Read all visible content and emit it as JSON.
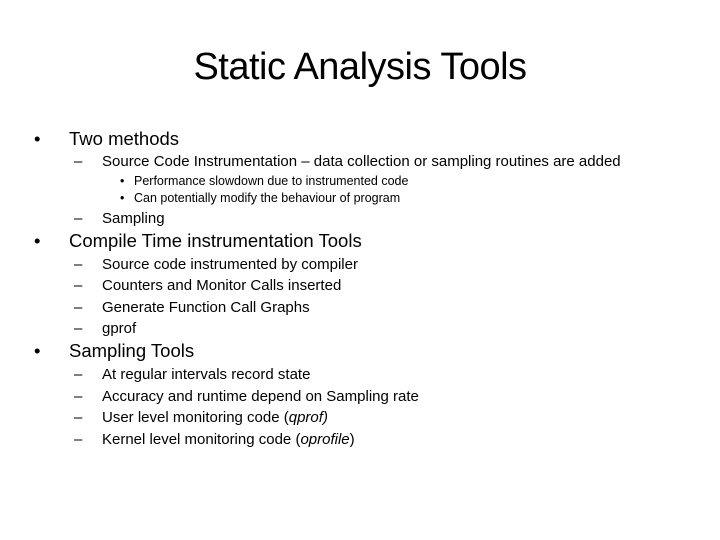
{
  "slide": {
    "title": "Static Analysis Tools",
    "sections": [
      {
        "label": "Two methods",
        "items": [
          {
            "label": "Source Code Instrumentation – data collection or sampling routines are added",
            "subitems": [
              "Performance slowdown due to instrumented code",
              "Can potentially modify the behaviour of program"
            ]
          },
          {
            "label": "Sampling"
          }
        ]
      },
      {
        "label": "Compile Time instrumentation Tools",
        "items": [
          {
            "label": "Source code instrumented by compiler"
          },
          {
            "label": "Counters and Monitor Calls inserted"
          },
          {
            "label": "Generate Function Call Graphs"
          },
          {
            "label": "gprof"
          }
        ]
      },
      {
        "label": "Sampling Tools",
        "items": [
          {
            "label": "At regular intervals record state"
          },
          {
            "label": "Accuracy and runtime depend on Sampling rate"
          },
          {
            "label": "User level monitoring code (",
            "italic": "qprof)",
            "suffix": ""
          },
          {
            "label": "Kernel level monitoring code (",
            "italic": "oprofile",
            "suffix": ")"
          }
        ]
      }
    ],
    "markers": {
      "bullet": "•",
      "dash": "–"
    }
  }
}
